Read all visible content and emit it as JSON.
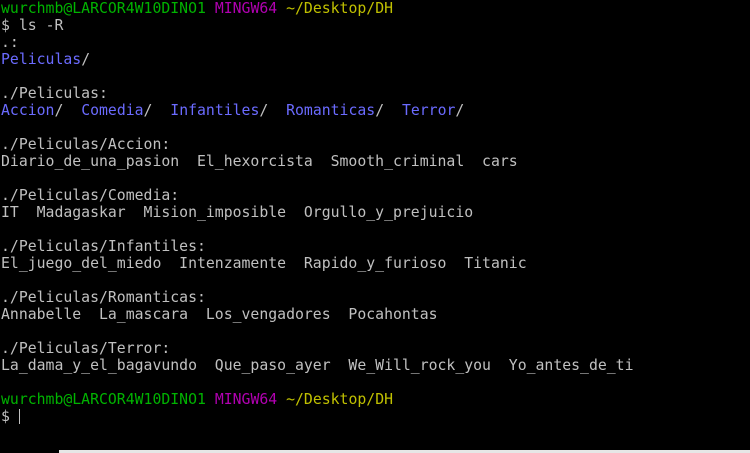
{
  "colors": {
    "background": "#000000",
    "text": "#c0c0c0",
    "user_host": "#00b300",
    "mingw": "#b100b1",
    "path": "#c0c000",
    "directory": "#6b6bff"
  },
  "prompt": {
    "user_host": "wurchmb@LARCOR4W10DINO1",
    "env": "MINGW64",
    "path": "~/Desktop/DH",
    "symbol": "$"
  },
  "command": "ls -R",
  "output": {
    "root_header": ".:",
    "root_dir": "Peliculas",
    "peliculas_header": "./Peliculas:",
    "peliculas_dirs": [
      "Accion",
      "Comedia",
      "Infantiles",
      "Romanticas",
      "Terror"
    ],
    "accion_header": "./Peliculas/Accion:",
    "accion_files": "Diario_de_una_pasion  El_hexorcista  Smooth_criminal  cars",
    "comedia_header": "./Peliculas/Comedia:",
    "comedia_files": "IT  Madagaskar  Mision_imposible  Orgullo_y_prejuicio",
    "infantiles_header": "./Peliculas/Infantiles:",
    "infantiles_files": "El_juego_del_miedo  Intenzamente  Rapido_y_furioso  Titanic",
    "romanticas_header": "./Peliculas/Romanticas:",
    "romanticas_files": "Annabelle  La_mascara  Los_vengadores  Pocahontas",
    "terror_header": "./Peliculas/Terror:",
    "terror_files": "La_dama_y_el_bagavundo  Que_paso_ayer  We_Will_rock_you  Yo_antes_de_ti"
  }
}
